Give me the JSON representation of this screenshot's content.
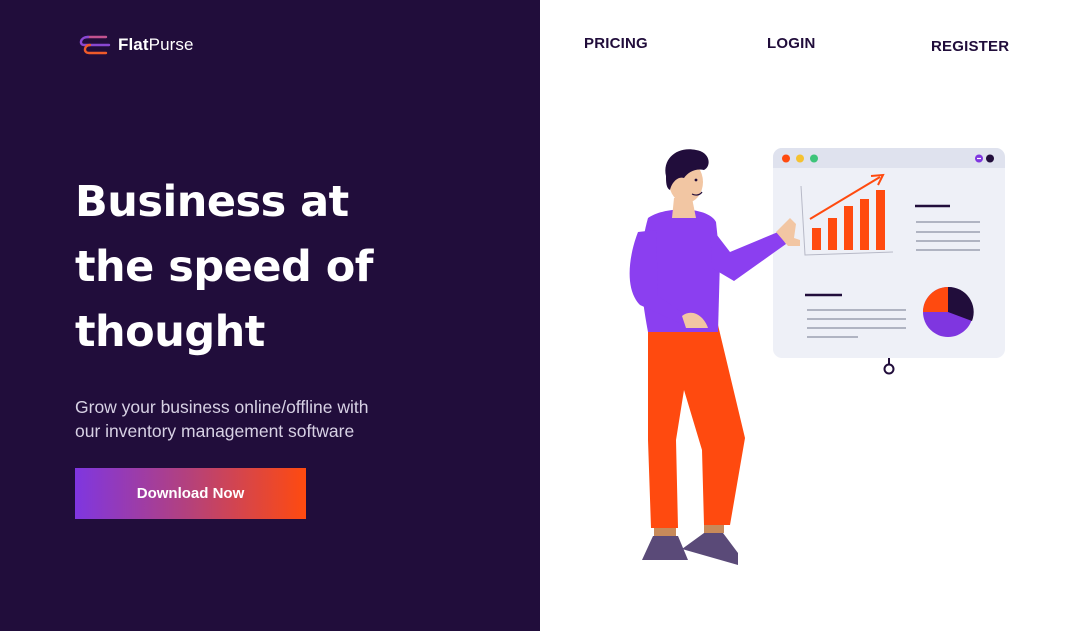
{
  "brand": {
    "name_bold": "Flat",
    "name_light": "Purse",
    "logo_icon": "flatpurse-logo-icon"
  },
  "nav": {
    "items": [
      {
        "label": "PRICING"
      },
      {
        "label": "LOGIN"
      },
      {
        "label": "REGISTER"
      }
    ]
  },
  "hero": {
    "title_lines": [
      "Business at",
      "the speed of",
      "thought"
    ],
    "subtitle_lines": [
      "Grow your business online/offline with",
      "our inventory management software"
    ],
    "cta_label": "Download Now"
  },
  "illustration": {
    "subject": "man-presenting-dashboard",
    "icons": [
      "bar-chart-icon",
      "pie-chart-icon",
      "trend-arrow-icon"
    ]
  },
  "colors": {
    "panel_bg": "#210d3b",
    "accent_purple": "#7f36e0",
    "accent_orange": "#ff4a0f",
    "page_bg": "#ffffff",
    "nav_text": "#210d3b"
  }
}
